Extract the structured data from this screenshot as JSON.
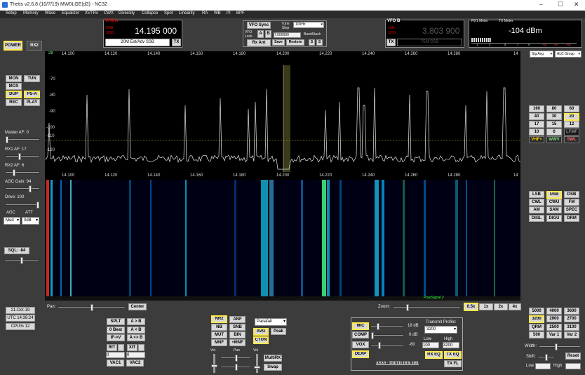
{
  "window": {
    "title": "Thetis v2.6.8 (10/7/19) MW0LGE(d3) - NC32",
    "min": "–",
    "max": "☐",
    "close": "✕"
  },
  "menu": [
    "Setup",
    "Memory",
    "Wave",
    "Equalizer",
    "XVTRs",
    "CWX",
    "Diversity",
    "Collapse",
    "Spot",
    "Linearity",
    "RA",
    "WB",
    "PI",
    "BPF"
  ],
  "power": {
    "power": "POWER",
    "rx2": "RX2"
  },
  "vfoa": {
    "label": "VFO A",
    "mode": "USB",
    "bw": "3200",
    "freq": "14.195 000",
    "band": "20M Ext/Adv SSB",
    "tx": "TX"
  },
  "vfosync": {
    "sync": "VFO Sync",
    "lock": "VFO Lock",
    "a": "A",
    "b": "B",
    "rxant": "Rx Ant",
    "tune": "Tune Step",
    "step": "100Hz",
    "offset": "7.000000",
    "bandstack": "BandStack",
    "save": "Save",
    "restore": "Restore",
    "s1": "S",
    "s2": "S"
  },
  "vfob": {
    "label": "VFO B",
    "mode": "LSB",
    "bw": "3200",
    "freq": "3.803 900",
    "band": "75M SSB",
    "tx": "TX"
  },
  "meter": {
    "rx1": "RX1 Meter",
    "tx": "TX Meter",
    "value": "-104 dBm",
    "scale": [
      "1",
      "3",
      "5",
      "7",
      "9",
      "+20",
      "+40",
      "+60"
    ]
  },
  "meterSelect": {
    "rx": "Sig Avg",
    "tx": "ALC Group"
  },
  "pan": {
    "xticks": [
      "14.100",
      "14.120",
      "14.140",
      "14.160",
      "14.180",
      "14.200",
      "14.220",
      "14.240",
      "14.260",
      "14.280",
      "14"
    ],
    "yticks": [
      "-70",
      "-80",
      "-90",
      "-100",
      "-110",
      "-120"
    ],
    "topval": "29",
    "puresignal": "PureSignal 2"
  },
  "left": {
    "mon": "MON",
    "tun": "TUN",
    "mox": "MOX",
    "dup": "DUP",
    "psa": "PS-A",
    "rec": "REC",
    "play": "PLAY",
    "masteraf": "Master AF: 0",
    "rx1af": "RX1 AF: 17",
    "rx2af": "RX2 AF: 6",
    "agcgain": "AGC Gain: 94",
    "drive": "Drive: 100",
    "agc": "AGC",
    "att": "ATT",
    "agcval": "Med",
    "attval": "0dB",
    "sql": "SQL: -84"
  },
  "bands": [
    "160",
    "80",
    "60",
    "40",
    "30",
    "20",
    "17",
    "15",
    "12",
    "10",
    "6",
    "LFMF",
    "VHF+",
    "WWV",
    "SWL"
  ],
  "modes": [
    "LSB",
    "USB",
    "DSB",
    "CWL",
    "CWU",
    "FM",
    "AM",
    "SAM",
    "SPEC",
    "DIGL",
    "DIGU",
    "DRM"
  ],
  "filters": [
    "5000",
    "4000",
    "3600",
    "3200",
    "2900",
    "2700",
    "QRM",
    "2500",
    "3100",
    "500",
    "Var 1",
    "Var 2"
  ],
  "filterctl": {
    "width": "Width:",
    "shift": "Shift:",
    "reset": "Reset",
    "low": "Low",
    "high": "High"
  },
  "status": {
    "date": "21-Oct-19",
    "utc": "UTC 14:38:24",
    "cpu": "CPU% 12"
  },
  "bottom": {
    "pan": "Pan:",
    "center": "Center",
    "zoom": "Zoom:",
    "z05": "0.5x",
    "z1": "1x",
    "z2": "2x",
    "z4": "4x"
  },
  "split": {
    "splt": "SPLT",
    "atob": "A > B",
    "zbeat": "0 Beat",
    "atb2": "A < B",
    "ifv": "IF->V",
    "aswap": "A <> B",
    "rit": "RIT",
    "xit": "XIT",
    "ritv": "0",
    "xitv": "0",
    "vac1": "VAC1",
    "vac2": "VAC2"
  },
  "dsp": {
    "nr2": "NR2",
    "anf": "ANF",
    "nb": "NB",
    "snb": "SNB",
    "mut": "MUT",
    "bin": "BIN",
    "mnf": "MNF",
    "pmnf": "+MNF",
    "display": "Panafall",
    "avg": "AVG",
    "peak": "Peak",
    "ctun": "CTUN",
    "vol": "Vol",
    "panl": "Pan",
    "vol2": "Vol",
    "multirx": "MultiRX",
    "swap": "Swap"
  },
  "tx": {
    "mic": "MIC",
    "micdb": "18 dB",
    "comp": "COMP",
    "compdb": "0 dB",
    "vox": "VOX",
    "voxv": "-60",
    "dexp": "DEXP",
    "profile": "Transmit Profile:",
    "profval": "3200",
    "low": "Low",
    "lowv": "100",
    "high": "High",
    "highv": "3200",
    "rxeq": "RX EQ",
    "txeq": "TX EQ",
    "txfl": "TX FL",
    "brand": "ANAN - THETIS HF& SDR"
  }
}
